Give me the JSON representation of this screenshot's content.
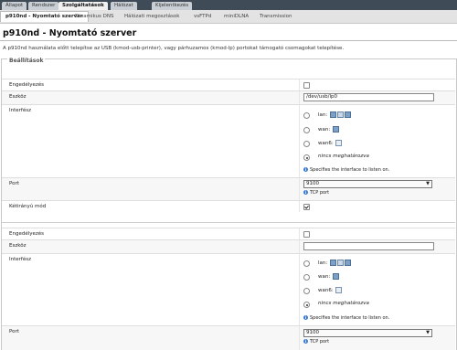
{
  "nav": {
    "tabs": [
      {
        "label": "Állapot"
      },
      {
        "label": "Rendszer"
      },
      {
        "label": "Szolgáltatások"
      },
      {
        "label": "Hálózat"
      },
      {
        "label": "Kijelentkezés"
      }
    ]
  },
  "subnav": {
    "tabs": [
      {
        "label": "p910nd - Nyomtató szerver"
      },
      {
        "label": "Dinamikus DNS"
      },
      {
        "label": "Hálózati megosztások"
      },
      {
        "label": "vsFTPd"
      },
      {
        "label": "miniDLNA"
      },
      {
        "label": "Transmission"
      }
    ]
  },
  "page": {
    "title": "p910nd - Nyomtató szerver",
    "description": "A p910nd használata előtt telepítse az USB (kmod-usb-printer), vagy párhuzamos (kmod-lp) portokat támogató csomagokat telepítése.",
    "section_title": "Beállítások"
  },
  "labels": {
    "enabled": "Engedélyezés",
    "device": "Eszköz",
    "interface": "Interfész",
    "port": "Port",
    "bidirectional": "Kétirányú mód"
  },
  "interfaces": [
    {
      "name": "lan:"
    },
    {
      "name": "wan:"
    },
    {
      "name": "wan6:"
    },
    {
      "name": "nincs meghatározva"
    }
  ],
  "hints": {
    "interface": "Specifies the interface to listen on.",
    "port": "TCP port"
  },
  "section1": {
    "enabled": false,
    "device": "/dev/usb/lp0",
    "port": "9100",
    "bidirectional": true
  },
  "section2": {
    "enabled": false,
    "device": "",
    "port": "9100"
  },
  "colors": {
    "topbar": "#3f4b56",
    "hint_icon": "#3a7bd5"
  }
}
